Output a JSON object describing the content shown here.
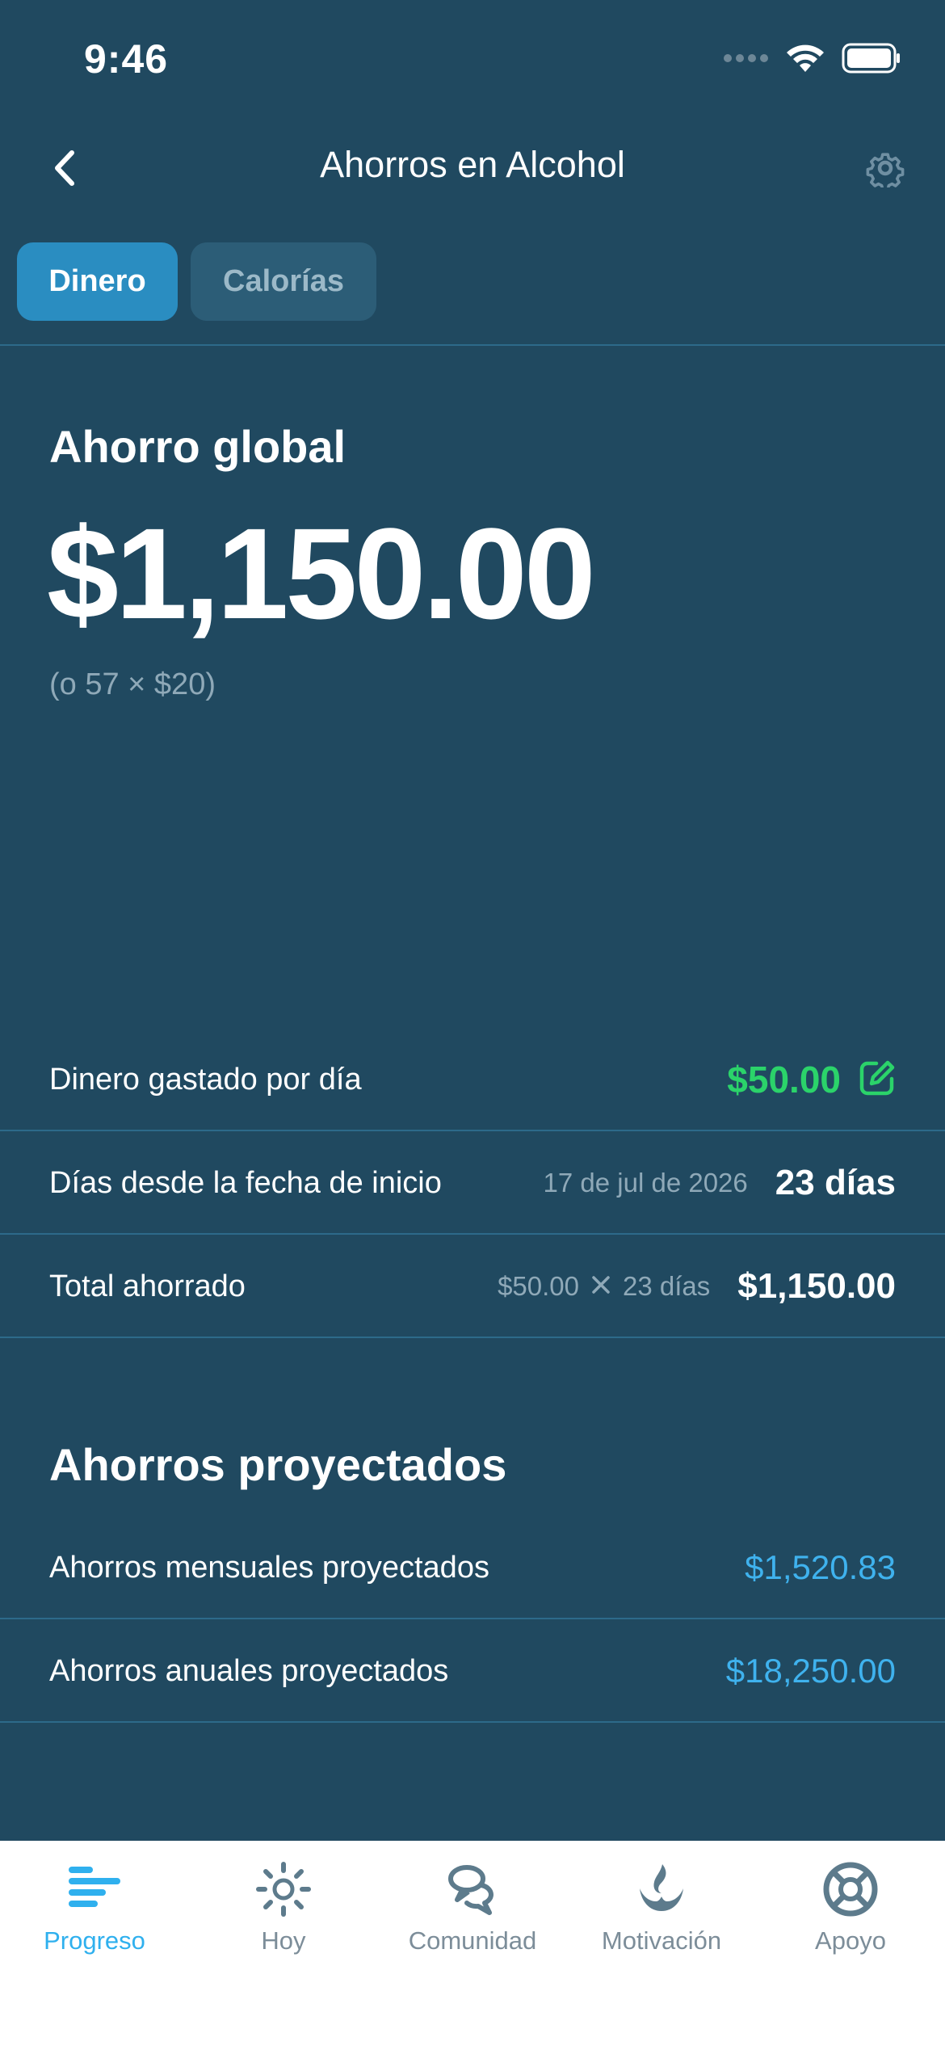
{
  "status": {
    "time": "9:46"
  },
  "nav": {
    "title": "Ahorros en Alcohol"
  },
  "tabs": [
    {
      "label": "Dinero",
      "active": true
    },
    {
      "label": "Calorías",
      "active": false
    }
  ],
  "hero": {
    "label": "Ahorro global",
    "amount": "$1,150.00",
    "sub": "(o 57 × $20)"
  },
  "rows": {
    "spent_per_day": {
      "label": "Dinero gastado por día",
      "value": "$50.00"
    },
    "days_since": {
      "label": "Días desde la fecha de inicio",
      "date": "17 de jul de 2026",
      "value": "23 días"
    },
    "total_saved": {
      "label": "Total ahorrado",
      "calc_amount": "$50.00",
      "calc_days": "23 días",
      "value": "$1,150.00"
    }
  },
  "projected": {
    "title": "Ahorros proyectados",
    "monthly": {
      "label": "Ahorros mensuales proyectados",
      "value": "$1,520.83"
    },
    "yearly": {
      "label": "Ahorros anuales proyectados",
      "value": "$18,250.00"
    }
  },
  "tabbar": [
    {
      "label": "Progreso",
      "icon": "progress-icon",
      "active": true
    },
    {
      "label": "Hoy",
      "icon": "sun-icon",
      "active": false
    },
    {
      "label": "Comunidad",
      "icon": "chat-bubbles-icon",
      "active": false
    },
    {
      "label": "Motivación",
      "icon": "flame-hands-icon",
      "active": false
    },
    {
      "label": "Apoyo",
      "icon": "lifebuoy-icon",
      "active": false
    }
  ],
  "colors": {
    "background": "#204960",
    "accent_blue": "#2a8dc1",
    "green": "#2bd36a",
    "link_blue": "#3fb2ee",
    "muted": "#8fa9b8"
  }
}
